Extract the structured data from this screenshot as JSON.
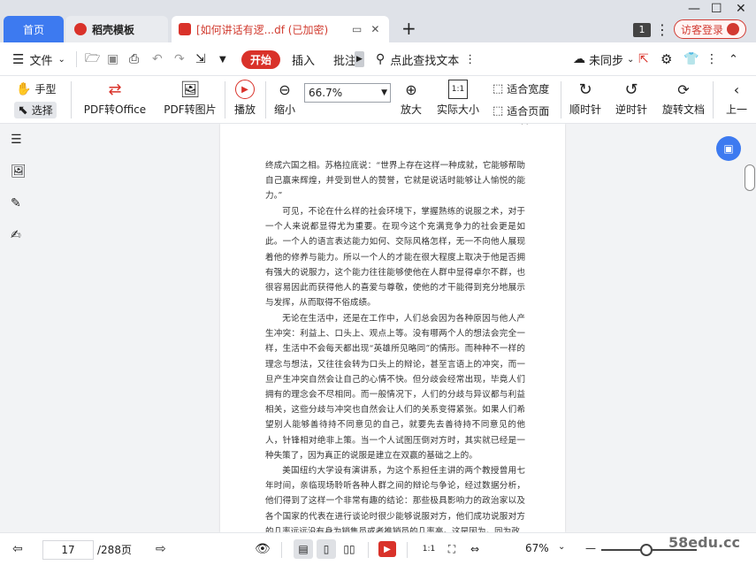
{
  "tabs": {
    "home": "首页",
    "docer": "稻壳模板",
    "doc_title": "[如何讲话有逻...df (已加密)"
  },
  "header": {
    "badge": "1",
    "login": "访客登录"
  },
  "menubar": {
    "file": "文件",
    "start": "开始",
    "insert": "插入",
    "annotate": "批注",
    "search_hint": "点此查找文本",
    "sync": "未同步"
  },
  "toolbar": {
    "hand": "手型",
    "select": "选择",
    "pdf_to_office": "PDF转Office",
    "pdf_to_image": "PDF转图片",
    "play": "播放",
    "zoom_out": "缩小",
    "zoom_value": "66.7%",
    "zoom_in": "放大",
    "actual_size": "实际大小",
    "fit_width": "适合宽度",
    "fit_page": "适合页面",
    "rotate_cw": "顺时针",
    "rotate_ccw": "逆时针",
    "rotate_doc": "旋转文档",
    "prev": "上一"
  },
  "document": {
    "page_mark": "· ·",
    "paragraphs": [
      "终成六国之相。苏格拉底说：“世界上存在这样一种成就，它能够帮助自己赢来辉煌，并受到世人的赞誉，它就是说话时能够让人愉悦的能力。”",
      "可见，不论在什么样的社会环境下，掌握熟练的说服之术，对于一个人来说都显得尤为重要。在现今这个充满竞争力的社会更是如此。一个人的语言表达能力如何、交际风格怎样，无一不向他人展现着他的修养与能力。所以一个人的才能在很大程度上取决于他是否拥有强大的说服力，这个能力往往能够使他在人群中显得卓尔不群，也很容易因此而获得他人的喜爱与尊敬，使他的才干能得到充分地展示与发挥，从而取得不俗成绩。",
      "无论在生活中，还是在工作中，人们总会因为各种原因与他人产生冲突：利益上、口头上、观点上等。没有哪两个人的想法会完全一样，生活中不会每天都出现“英雄所见略同”的情形。而种种不一样的理念与想法，又往往会转为口头上的辩论，甚至言语上的冲突，而一旦产生冲突自然会让自己的心情不快。但分歧会经常出现，毕竟人们拥有的理念会不尽相同。而一般情况下，人们的分歧与异议都与利益相关，这些分歧与冲突也自然会让人们的关系变得紧张。如果人们希望别人能够善待持不同意见的自己，就要先去善待持不同意见的他人，针锋相对绝非上策。当一个人试图压倒对方时，其实就已经是一种失策了，因为真正的说服是建立在双赢的基础之上的。",
      "美国纽约大学设有演讲系，为这个系担任主讲的两个教授曾用七年时间，亲临现场聆听各种人群之间的辩论与争论，经过数据分析，他们得到了这样一个非常有趣的结论：那些极具影响力的政治家以及各个国家的代表在进行谈论时很少能够说服对方，他们成功说服对方的几率远远没有身为销售员或者推销员的几率高。这是因为，同为政"
    ]
  },
  "status": {
    "page_current": "17",
    "page_total": "/288页",
    "zoom": "67%"
  },
  "watermark": "58edu.cc",
  "colors": {
    "accent_blue": "#3d7af0",
    "brand_red": "#d9322a"
  }
}
